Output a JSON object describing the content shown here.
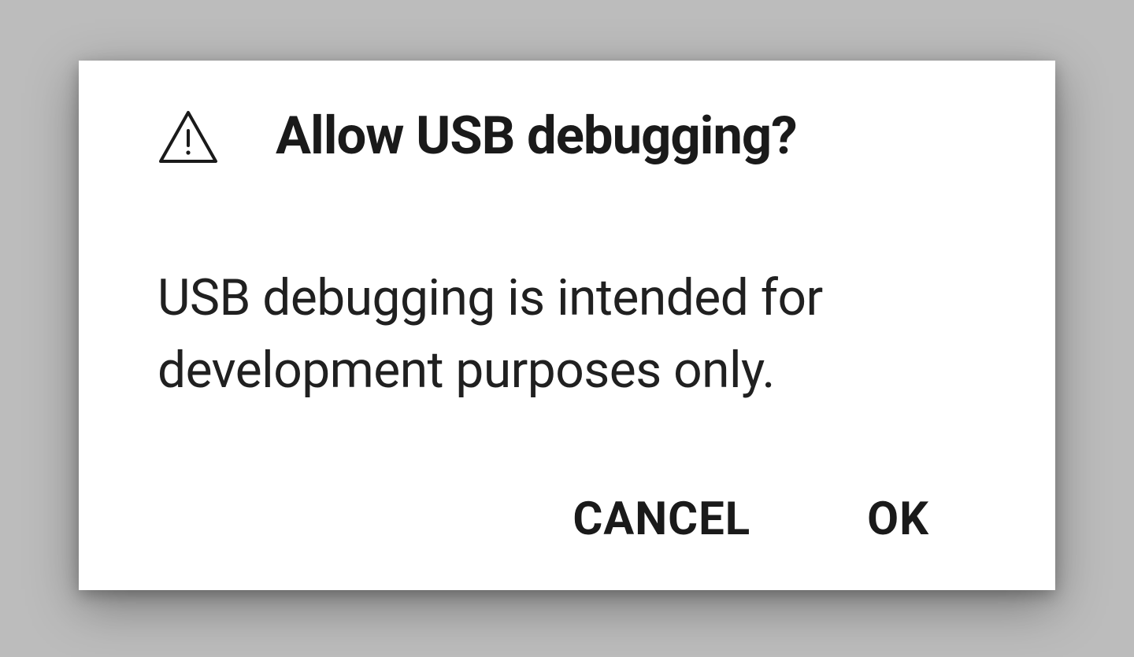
{
  "dialog": {
    "title": "Allow USB debugging?",
    "body": "USB debugging is intended for development purposes only.",
    "cancel_label": "CANCEL",
    "ok_label": "OK"
  }
}
